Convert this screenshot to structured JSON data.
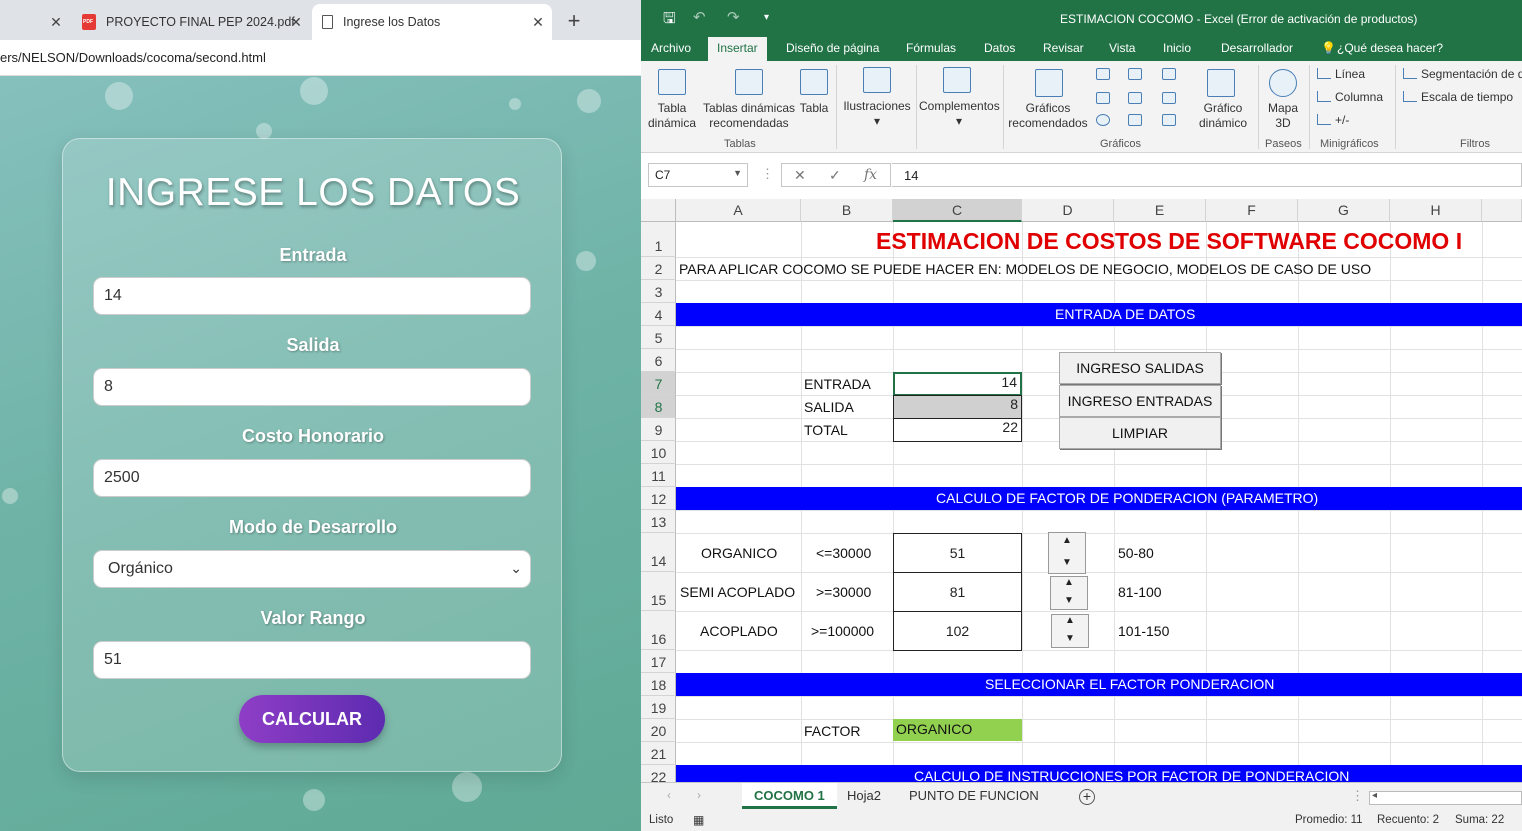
{
  "browser": {
    "tabs": [
      {
        "label": "",
        "icon": "close-icon"
      },
      {
        "label": "PROYECTO FINAL PEP 2024.pdf",
        "icon": "pdf-icon"
      },
      {
        "label": "Ingrese los Datos",
        "icon": "page-icon"
      }
    ],
    "address": "ers/NELSON/Downloads/cocoma/second.html",
    "form": {
      "title": "INGRESE LOS DATOS",
      "entrada_label": "Entrada",
      "entrada_value": "14",
      "salida_label": "Salida",
      "salida_value": "8",
      "costo_label": "Costo Honorario",
      "costo_value": "2500",
      "modo_label": "Modo de Desarrollo",
      "modo_value": "Orgánico",
      "rango_label": "Valor Rango",
      "rango_value": "51",
      "calc_label": "CALCULAR"
    }
  },
  "excel": {
    "window_title": "ESTIMACION COCOMO - Excel (Error de activación de productos)",
    "menu": [
      "Archivo",
      "Insertar",
      "Diseño de página",
      "Fórmulas",
      "Datos",
      "Revisar",
      "Vista",
      "Inicio",
      "Desarrollador",
      "¿Qué desea hacer?"
    ],
    "ribbon": {
      "tabla_dinamica": [
        "Tabla",
        "dinámica"
      ],
      "tablas_recomendadas": [
        "Tablas dinámicas",
        "recomendadas"
      ],
      "tabla": "Tabla",
      "ilustraciones": "Ilustraciones",
      "complementos": "Complementos",
      "graficos_recomendados": [
        "Gráficos",
        "recomendados"
      ],
      "grafico_dinamico": [
        "Gráfico",
        "dinámico"
      ],
      "mapa": [
        "Mapa",
        "3D"
      ],
      "linea": "Línea",
      "columna": "Columna",
      "ganancia": "+/-",
      "segmentacion": "Segmentación de d",
      "escala": "Escala de tiempo",
      "groups": [
        "Tablas",
        "Gráficos",
        "Paseos",
        "Minigráficos",
        "Filtros"
      ]
    },
    "name_box": "C7",
    "formula": "14",
    "columns": [
      "A",
      "B",
      "C",
      "D",
      "E",
      "F",
      "G",
      "H"
    ],
    "rows": [
      "1",
      "2",
      "3",
      "4",
      "5",
      "6",
      "7",
      "8",
      "9",
      "10",
      "11",
      "12",
      "13",
      "14",
      "15",
      "16",
      "17",
      "18",
      "19",
      "20",
      "21",
      "22"
    ],
    "cells": {
      "title": "ESTIMACION DE COSTOS DE SOFTWARE COCOMO I",
      "subtitle": "PARA APLICAR COCOMO SE PUEDE HACER EN: MODELOS DE NEGOCIO, MODELOS DE CASO DE USO",
      "band_entrada": "ENTRADA DE DATOS",
      "entrada_label": "ENTRADA",
      "entrada_value": "14",
      "salida_label": "SALIDA",
      "salida_value": "8",
      "total_label": "TOTAL",
      "total_value": "22",
      "btn_salidas": "INGRESO SALIDAS",
      "btn_entradas": "INGRESO ENTRADAS",
      "btn_limpiar": "LIMPIAR",
      "band_calculo": "CALCULO DE FACTOR DE PONDERACION (PARAMETRO)",
      "organico": "ORGANICO",
      "organico_cond": "<=30000",
      "organico_value": "51",
      "organico_range": "50-80",
      "semi": "SEMI ACOPLADO",
      "semi_cond": ">=30000",
      "semi_value": "81",
      "semi_range": "81-100",
      "acoplado": "ACOPLADO",
      "acoplado_cond": ">=100000",
      "acoplado_value": "102",
      "acoplado_range": "101-150",
      "band_seleccionar": "SELECCIONAR EL FACTOR PONDERACION",
      "factor_label": "FACTOR",
      "factor_value": "ORGANICO",
      "band_instrucciones": "CALCULO DE INSTRUCCIONES POR FACTOR DE PONDERACION"
    },
    "sheets": [
      "COCOMO 1",
      "Hoja2",
      "PUNTO DE FUNCION"
    ],
    "status": {
      "ready": "Listo",
      "promedio": "Promedio: 11",
      "recuento": "Recuento: 2",
      "suma": "Suma: 22"
    },
    "colors": {
      "excel_green": "#217346",
      "band_blue": "#0000ff",
      "title_red": "#e00000",
      "factor_green": "#92d050"
    }
  }
}
